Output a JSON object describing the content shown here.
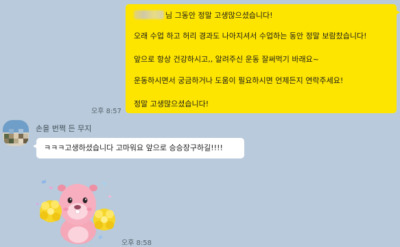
{
  "messages": {
    "mine": {
      "line1": "님 그동안 정말 고생많으셨습니다!",
      "line2": "오래 수업 하고 허리 경과도 나아지셔서 수업하는 동안 정말 보람찼습니다!",
      "line3": "앞으로 항상 건강하시고,, 알려주신 운동 잘써먹기 바래요~",
      "line4": "운동하시면서 궁금하거나 도움이 필요하시면 언제든지 연락주세요!",
      "line5": "정말 고생많으셨습니다!",
      "time": "오후 8:57"
    },
    "other": {
      "sender": "손을 번쩍 든 무지",
      "text": "ㅋㅋㅋ고생하셨습니다 고마워요 앞으로 승승장구하길!!!!",
      "sticker_time": "오후 8:58"
    }
  },
  "colors": {
    "background": "#b8cadb",
    "my_bubble": "#fee500",
    "other_bubble": "#ffffff"
  },
  "icons": {
    "sticker": "pink-beaver-cheerleader-sticker",
    "avatar": "profile-avatar"
  }
}
